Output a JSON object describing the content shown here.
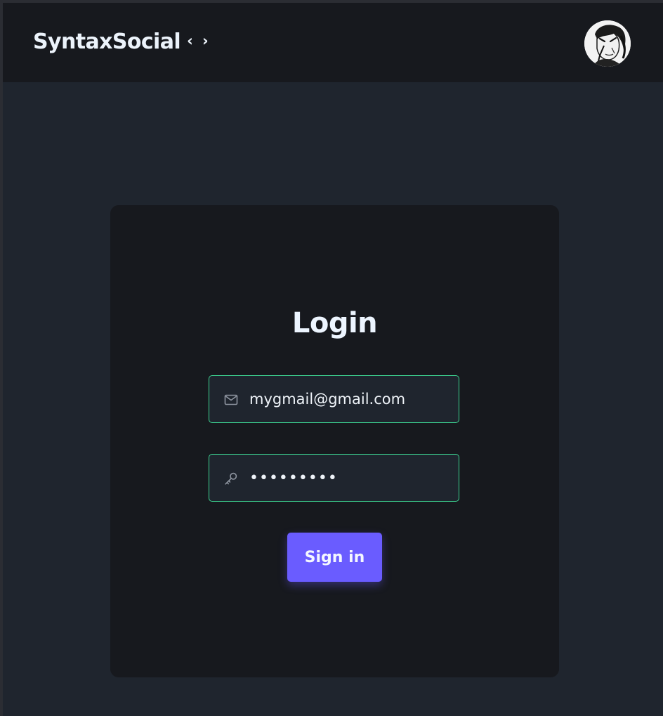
{
  "navbar": {
    "brand": "SyntaxSocial",
    "brand_icon": "code-brackets-icon",
    "avatar": "user-avatar"
  },
  "login": {
    "title": "Login",
    "email": {
      "icon": "mail-icon",
      "value": "mygmail@gmail.com"
    },
    "password": {
      "icon": "key-icon",
      "value": "•••••••••"
    },
    "submit_label": "Sign in"
  },
  "colors": {
    "page_background": "#1f252e",
    "navbar_background": "#17191e",
    "card_background": "#17191e",
    "input_border": "#3cd491",
    "button_background": "#6a5cff",
    "text": "#edf5ff"
  }
}
